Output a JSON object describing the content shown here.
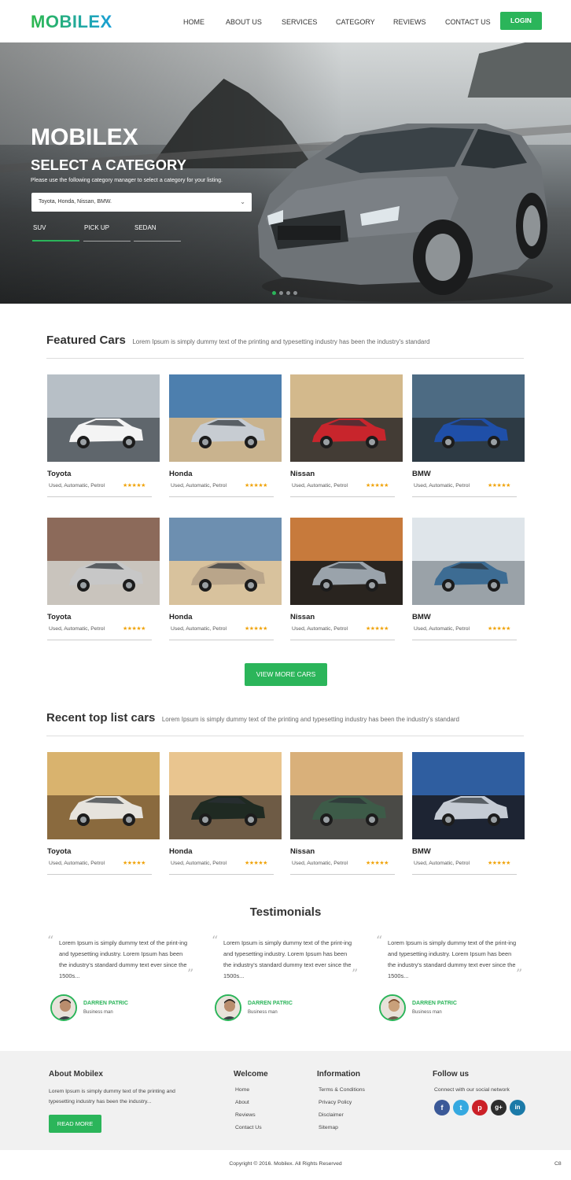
{
  "header": {
    "logo": "MOBILEX",
    "nav": [
      "HOME",
      "ABOUT US",
      "SERVICES",
      "CATEGORY",
      "REVIEWS",
      "CONTACT US"
    ],
    "login": "LOGIN"
  },
  "hero": {
    "title": "MOBILEX",
    "subtitle": "SELECT A CATEGORY",
    "description": "Please use the following category manager to select a category for your listing.",
    "select_value": "Toyota, Honda, Nissan, BMW.",
    "tabs": [
      "SUV",
      "PICK UP",
      "SEDAN"
    ],
    "active_tab": "SUV",
    "slide_count": 4,
    "active_slide": 1
  },
  "featured": {
    "title": "Featured Cars",
    "description": "Lorem Ipsum is simply dummy text of the printing and typesetting industry has been the industry's standard",
    "cars": [
      {
        "name": "Toyota",
        "spec": "Used, Automatic, Petrol",
        "stars": "★★★★★"
      },
      {
        "name": "Honda",
        "spec": "Used, Automatic, Petrol",
        "stars": "★★★★★"
      },
      {
        "name": "Nissan",
        "spec": "Used, Automatic, Petrol",
        "stars": "★★★★★"
      },
      {
        "name": "BMW",
        "spec": "Used, Automatic, Petrol",
        "stars": "★★★★★"
      },
      {
        "name": "Toyota",
        "spec": "Used, Automatic, Petrol",
        "stars": "★★★★★"
      },
      {
        "name": "Honda",
        "spec": "Used, Automatic, Petrol",
        "stars": "★★★★★"
      },
      {
        "name": "Nissan",
        "spec": "Used, Automatic, Petrol",
        "stars": "★★★★★"
      },
      {
        "name": "BMW",
        "spec": "Used, Automatic, Petrol",
        "stars": "★★★★★"
      }
    ],
    "view_more": "VIEW MORE CARS"
  },
  "recent": {
    "title": "Recent top list cars",
    "description": "Lorem Ipsum is simply dummy text of the printing and typesetting industry has been the industry's standard",
    "cars": [
      {
        "name": "Toyota",
        "spec": "Used, Automatic, Petrol",
        "stars": "★★★★★"
      },
      {
        "name": "Honda",
        "spec": "Used, Automatic, Petrol",
        "stars": "★★★★★"
      },
      {
        "name": "Nissan",
        "spec": "Used, Automatic, Petrol",
        "stars": "★★★★★"
      },
      {
        "name": "BMW",
        "spec": "Used, Automatic, Petrol",
        "stars": "★★★★★"
      }
    ]
  },
  "testimonials": {
    "title": "Testimonials",
    "items": [
      {
        "quote": "Lorem Ipsum is simply dummy text of the print-ing and typesetting industry. Lorem Ipsum has been the industry's standard dummy text ever since the 1500s...",
        "name": "DARREN PATRIC",
        "role": "Business man"
      },
      {
        "quote": "Lorem Ipsum is simply dummy text of the print-ing and typesetting industry. Lorem Ipsum has been the industry's standard dummy text ever since the 1500s...",
        "name": "DARREN PATRIC",
        "role": "Business man"
      },
      {
        "quote": "Lorem Ipsum is simply dummy text of the print-ing and typesetting industry. Lorem Ipsum has been the industry's standard dummy text ever since the 1500s...",
        "name": "DARREN PATRIC",
        "role": "Business man"
      }
    ]
  },
  "footer": {
    "about": {
      "title": "About Mobilex",
      "text": "Lorem Ipsum is simply dummy text of the printing and typesetting industry has been the industry...",
      "button": "READ MORE"
    },
    "welcome": {
      "title": "Welcome",
      "links": [
        "Home",
        "About",
        "Reviews",
        "Contact Us"
      ]
    },
    "information": {
      "title": "Information",
      "links": [
        "Terms & Conditions",
        "Privacy Policy",
        "Disclaimer",
        "Sitemap"
      ]
    },
    "follow": {
      "title": "Follow us",
      "text": "Connect with our social network",
      "icons": [
        "facebook-icon",
        "twitter-icon",
        "pinterest-icon",
        "google-plus-icon",
        "linkedin-icon"
      ],
      "glyphs": [
        "f",
        "t",
        "p",
        "g+",
        "in"
      ]
    },
    "copyright": "Copyright © 2016. Mobilex. All Rights Reserved",
    "corner": "C8"
  },
  "colors": {
    "accent": "#2bb55a",
    "logo_gradient_end": "#1a9fd8",
    "stars": "#f0a30a"
  }
}
